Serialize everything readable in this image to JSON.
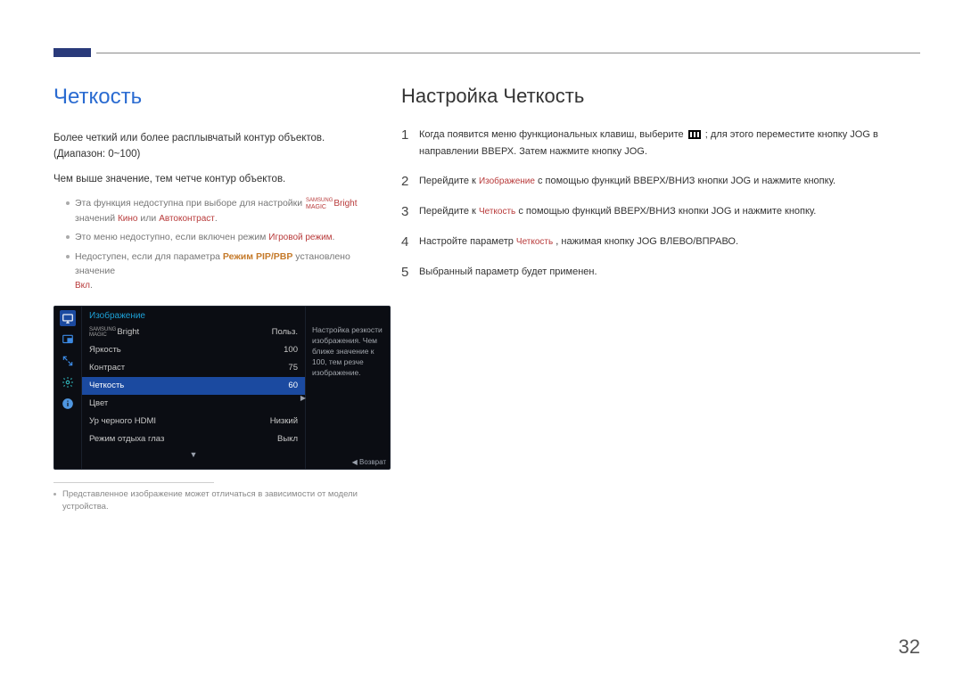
{
  "left": {
    "heading": "Четкость",
    "intro": "Более четкий или более расплывчатый контур объектов. (Диапазон: 0~100)",
    "line2": "Чем выше значение, тем четче контур объектов.",
    "notes": {
      "n1_pre": "Эта функция недоступна при выборе для настройки ",
      "n1_bright": "Bright",
      "n1_mid": " значений ",
      "n1_v1": "Кино",
      "n1_or": " или ",
      "n1_v2": "Автоконтраст",
      "n1_end": ".",
      "n2_pre": "Это меню недоступно, если включен режим ",
      "n2_mode": "Игровой режим",
      "n2_end": ".",
      "n3_pre": "Недоступен, если для параметра ",
      "n3_param": "Режим PIP/PBP",
      "n3_mid": " установлено значение ",
      "n3_val": "Вкл",
      "n3_end": "."
    },
    "image_note": "Представленное изображение может отличаться в зависимости от модели устройства."
  },
  "osd": {
    "title": "Изображение",
    "bright_prefix1": "SAMSUNG",
    "bright_prefix2": "MAGIC",
    "bright_label": "Bright",
    "rows": [
      {
        "label": "Яркость",
        "value": "100"
      },
      {
        "label": "Контраст",
        "value": "75"
      },
      {
        "label": "Четкость",
        "value": "60"
      },
      {
        "label": "Цвет",
        "value": ""
      },
      {
        "label": "Ур черного HDMI",
        "value": "Низкий"
      },
      {
        "label": "Режим отдыха глаз",
        "value": "Выкл"
      }
    ],
    "bright_value": "Польз.",
    "down": "▼",
    "help": "Настройка резкости изображения. Чем ближе значение к 100, тем резче изображение.",
    "return": "◀ Возврат"
  },
  "right": {
    "heading": "Настройка Четкость",
    "s1_pre": "Когда появится меню функциональных клавиш, выберите ",
    "s1_post": " ; для этого переместите кнопку JOG в направлении ВВЕРХ. Затем нажмите кнопку JOG.",
    "s2_pre": "Перейдите к ",
    "s2_target": "Изображение",
    "s2_post": " с помощью функций ВВЕРХ/ВНИЗ кнопки JOG и нажмите кнопку.",
    "s3_pre": "Перейдите к ",
    "s3_target": "Четкость",
    "s3_post": " с помощью функций ВВЕРХ/ВНИЗ кнопки JOG и нажмите кнопку.",
    "s4_pre": "Настройте параметр ",
    "s4_target": "Четкость",
    "s4_post": " , нажимая кнопку JOG ВЛЕВО/ВПРАВО.",
    "s5": "Выбранный параметр будет применен."
  },
  "nums": {
    "n1": "1",
    "n2": "2",
    "n3": "3",
    "n4": "4",
    "n5": "5"
  },
  "page_number": "32"
}
